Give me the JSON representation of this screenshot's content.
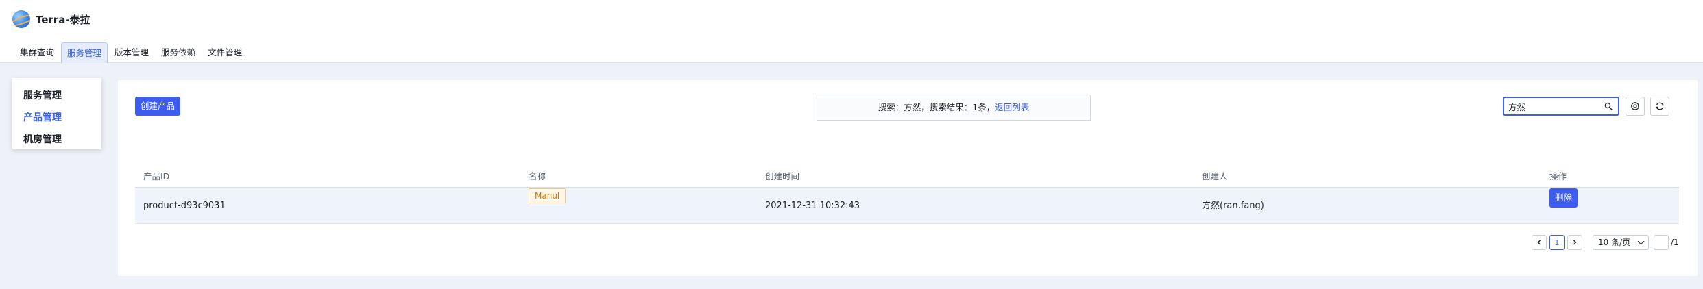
{
  "app": {
    "title": "Terra-泰拉"
  },
  "nav": {
    "tabs": [
      {
        "label": "集群查询"
      },
      {
        "label": "服务管理",
        "active": true
      },
      {
        "label": "版本管理"
      },
      {
        "label": "服务依赖"
      },
      {
        "label": "文件管理"
      }
    ]
  },
  "sidebar": {
    "items": [
      {
        "label": "服务管理"
      },
      {
        "label": "产品管理",
        "active": true
      },
      {
        "label": "机房管理"
      }
    ]
  },
  "toolbar": {
    "create_label": "创建产品",
    "search_value": "方然",
    "settings_icon": "settings-icon",
    "refresh_icon": "refresh-icon"
  },
  "search_result": {
    "text": "搜索：方然，搜索结果：1条，",
    "back_link": "返回列表"
  },
  "table": {
    "columns": [
      "产品ID",
      "名称",
      "创建时间",
      "创建人",
      "操作"
    ],
    "rows": [
      {
        "id": "product-d93c9031",
        "name": "Manul",
        "created": "2021-12-31 10:32:43",
        "creator": "方然(ran.fang)",
        "action": "删除"
      }
    ]
  },
  "pagination": {
    "current": "1",
    "page_size": "10 条/页",
    "total_pages": "/1"
  },
  "colors": {
    "accent": "#3d5cf0",
    "tag_text": "#c87a12",
    "tag_bg": "#fff6e5"
  }
}
